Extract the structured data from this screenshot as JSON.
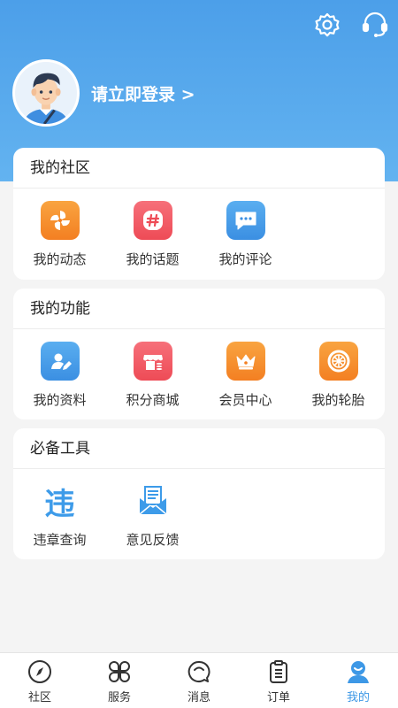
{
  "header": {
    "login_label": "请立即登录 >",
    "icons": [
      "settings-icon",
      "headset-icon"
    ]
  },
  "community": {
    "title": "我的社区",
    "items": [
      {
        "label": "我的动态",
        "icon": "pinwheel-icon",
        "color": "#f7922f"
      },
      {
        "label": "我的话题",
        "icon": "hashtag-icon",
        "color": "#f25a62"
      },
      {
        "label": "我的评论",
        "icon": "comment-icon",
        "color": "#3d9be9"
      }
    ]
  },
  "functions": {
    "title": "我的功能",
    "items": [
      {
        "label": "我的资料",
        "icon": "profile-edit-icon",
        "color": "#3d9be9"
      },
      {
        "label": "积分商城",
        "icon": "store-icon",
        "color": "#f25a62"
      },
      {
        "label": "会员中心",
        "icon": "crown-icon",
        "color": "#f7922f"
      },
      {
        "label": "我的轮胎",
        "icon": "tire-icon",
        "color": "#f7922f"
      }
    ]
  },
  "tools": {
    "title": "必备工具",
    "items": [
      {
        "label": "违章查询",
        "icon": "violation-icon",
        "glyph": "违",
        "color": "#3d9be9"
      },
      {
        "label": "意见反馈",
        "icon": "feedback-mail-icon",
        "color": "#3d9be9"
      }
    ]
  },
  "tabbar": {
    "active": "我的",
    "active_color": "#3d98e6",
    "tabs": [
      {
        "label": "社区",
        "icon": "compass-icon"
      },
      {
        "label": "服务",
        "icon": "grid-petals-icon"
      },
      {
        "label": "消息",
        "icon": "chat-bubble-icon"
      },
      {
        "label": "订单",
        "icon": "clipboard-icon"
      },
      {
        "label": "我的",
        "icon": "user-icon"
      }
    ]
  }
}
